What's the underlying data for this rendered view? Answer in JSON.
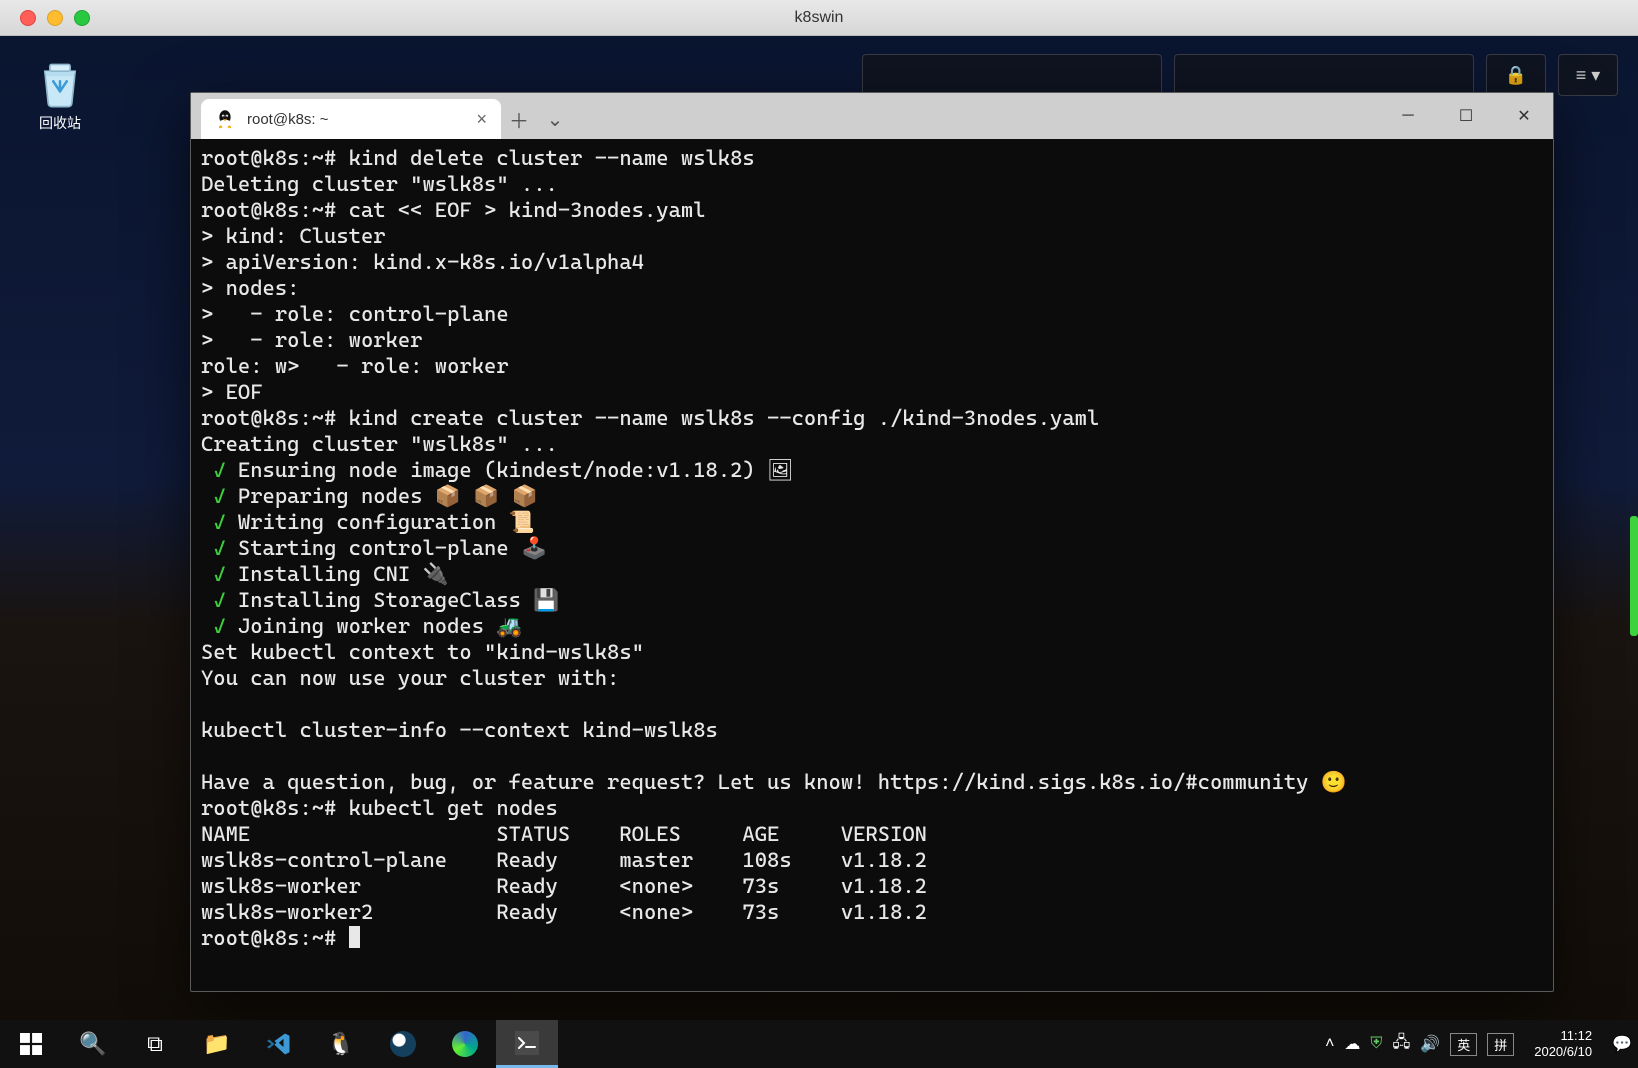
{
  "mac": {
    "title": "k8swin"
  },
  "desktop": {
    "recycle_label": "回收站",
    "top_widget_icons": [
      "🔒",
      "≡ ▾"
    ]
  },
  "terminal": {
    "tab": {
      "title": "root@k8s: ~"
    },
    "lines": [
      {
        "t": "root@k8s:~# kind delete cluster --name wslk8s"
      },
      {
        "t": "Deleting cluster \"wslk8s\" ..."
      },
      {
        "t": "root@k8s:~# cat << EOF > kind-3nodes.yaml"
      },
      {
        "t": "> kind: Cluster"
      },
      {
        "t": "> apiVersion: kind.x-k8s.io/v1alpha4"
      },
      {
        "t": "> nodes:"
      },
      {
        "t": ">   - role: control-plane"
      },
      {
        "t": ">   - role: worker"
      },
      {
        "t": "role: w>   - role: worker"
      },
      {
        "t": "> EOF"
      },
      {
        "t": "root@k8s:~# kind create cluster --name wslk8s --config ./kind-3nodes.yaml"
      },
      {
        "t": "Creating cluster \"wslk8s\" ..."
      },
      {
        "chk": true,
        "t": "Ensuring node image (kindest/node:v1.18.2) 🖼"
      },
      {
        "chk": true,
        "t": "Preparing nodes 📦 📦 📦"
      },
      {
        "chk": true,
        "t": "Writing configuration 📜"
      },
      {
        "chk": true,
        "t": "Starting control-plane 🕹️"
      },
      {
        "chk": true,
        "t": "Installing CNI 🔌"
      },
      {
        "chk": true,
        "t": "Installing StorageClass 💾"
      },
      {
        "chk": true,
        "t": "Joining worker nodes 🚜"
      },
      {
        "t": "Set kubectl context to \"kind-wslk8s\""
      },
      {
        "t": "You can now use your cluster with:"
      },
      {
        "t": ""
      },
      {
        "t": "kubectl cluster-info --context kind-wslk8s"
      },
      {
        "t": ""
      },
      {
        "t": "Have a question, bug, or feature request? Let us know! https://kind.sigs.k8s.io/#community 🙂"
      },
      {
        "t": "root@k8s:~# kubectl get nodes"
      }
    ],
    "table": {
      "headers": [
        "NAME",
        "STATUS",
        "ROLES",
        "AGE",
        "VERSION"
      ],
      "rows": [
        [
          "wslk8s-control-plane",
          "Ready",
          "master",
          "108s",
          "v1.18.2"
        ],
        [
          "wslk8s-worker",
          "Ready",
          "<none>",
          "73s",
          "v1.18.2"
        ],
        [
          "wslk8s-worker2",
          "Ready",
          "<none>",
          "73s",
          "v1.18.2"
        ]
      ]
    },
    "prompt_final": "root@k8s:~# "
  },
  "taskbar": {
    "tray": {
      "ime1": "英",
      "ime2": "拼"
    },
    "clock": {
      "time": "11:12",
      "date": "2020/6/10"
    }
  }
}
